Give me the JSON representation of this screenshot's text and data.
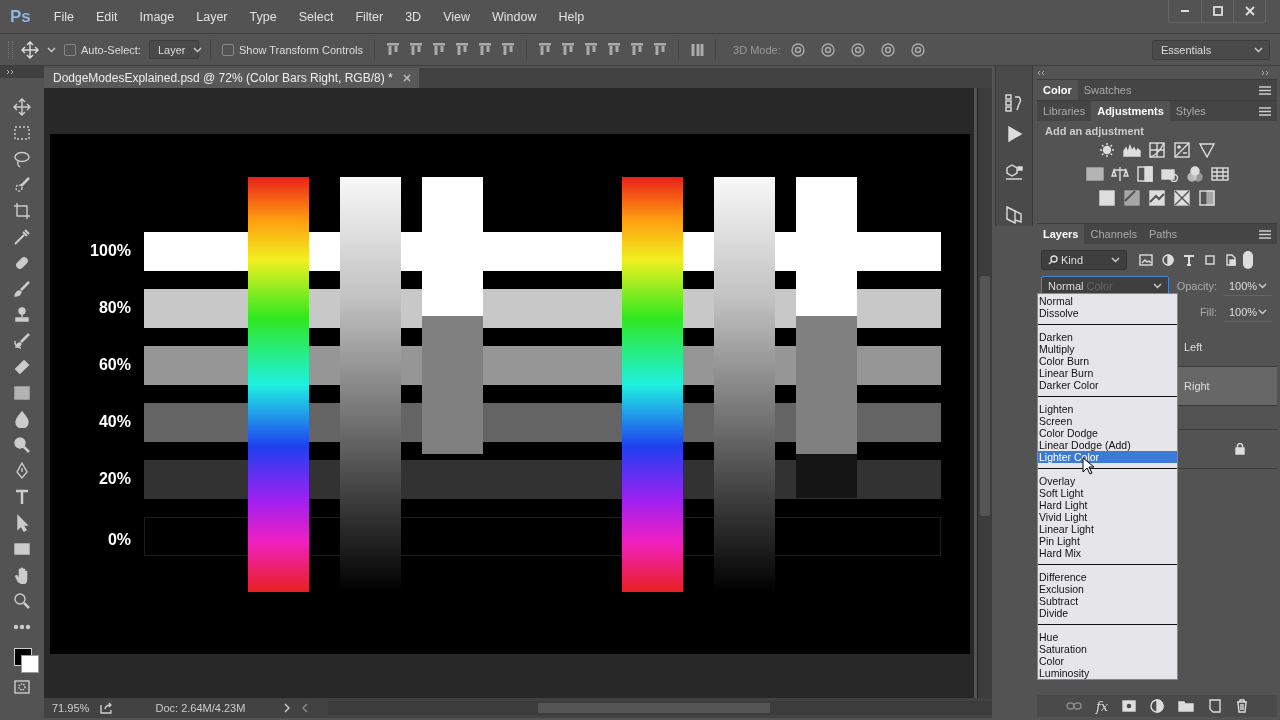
{
  "app": {
    "logo": "Ps",
    "menu": [
      "File",
      "Edit",
      "Image",
      "Layer",
      "Type",
      "Select",
      "Filter",
      "3D",
      "View",
      "Window",
      "Help"
    ]
  },
  "options_bar": {
    "auto_select": {
      "label": "Auto-Select:",
      "checked": false
    },
    "auto_select_target": "Layer",
    "show_transform": {
      "label": "Show Transform Controls",
      "checked": false
    },
    "mode_3d_label": "3D Mode:",
    "workspace": "Essentials"
  },
  "document": {
    "tab_title": "DodgeModesExplained.psd @ 72% (Color Bars Right, RGB/8) *",
    "canvas_labels": [
      "100%",
      "80%",
      "60%",
      "40%",
      "20%",
      "0%"
    ]
  },
  "status_bar": {
    "zoom": "71.95%",
    "doc_info": "Doc: 2.64M/4.23M"
  },
  "color_group": {
    "tabs": [
      {
        "label": "Color",
        "selected": true
      },
      {
        "label": "Swatches",
        "selected": false
      }
    ]
  },
  "adjustments_group": {
    "tabs": [
      {
        "label": "Libraries",
        "selected": false
      },
      {
        "label": "Adjustments",
        "selected": true
      },
      {
        "label": "Styles",
        "selected": false
      }
    ],
    "heading": "Add an adjustment"
  },
  "layers_group": {
    "tabs": [
      {
        "label": "Layers",
        "selected": true
      },
      {
        "label": "Channels",
        "selected": false
      },
      {
        "label": "Paths",
        "selected": false
      }
    ],
    "filter_kind": "Kind",
    "blend_mode": "Normal",
    "blend_mode_preview": "Color",
    "opacity_label": "Opacity:",
    "opacity": "100%",
    "fill_label": "Fill:",
    "fill": "100%",
    "layers": [
      {
        "name": "Left",
        "selected": false,
        "locked": false
      },
      {
        "name": "Right",
        "selected": true,
        "locked": false
      },
      {
        "selected": false,
        "locked": false
      },
      {
        "selected": false,
        "locked": true
      }
    ],
    "footer_fx": "fx"
  },
  "blend_menu": {
    "groups": [
      [
        {
          "label": "Normal",
          "selected": false
        },
        {
          "label": "Dissolve",
          "selected": false
        }
      ],
      [
        {
          "label": "Darken",
          "selected": false
        },
        {
          "label": "Multiply",
          "selected": false
        },
        {
          "label": "Color Burn",
          "selected": false
        },
        {
          "label": "Linear Burn",
          "selected": false
        },
        {
          "label": "Darker Color",
          "selected": false
        }
      ],
      [
        {
          "label": "Lighten",
          "selected": false
        },
        {
          "label": "Screen",
          "selected": false
        },
        {
          "label": "Color Dodge",
          "selected": false
        },
        {
          "label": "Linear Dodge (Add)",
          "selected": false
        },
        {
          "label": "Lighter Color",
          "selected": true
        }
      ],
      [
        {
          "label": "Overlay",
          "selected": false
        },
        {
          "label": "Soft Light",
          "selected": false
        },
        {
          "label": "Hard Light",
          "selected": false
        },
        {
          "label": "Vivid Light",
          "selected": false
        },
        {
          "label": "Linear Light",
          "selected": false
        },
        {
          "label": "Pin Light",
          "selected": false
        },
        {
          "label": "Hard Mix",
          "selected": false
        }
      ],
      [
        {
          "label": "Difference",
          "selected": false
        },
        {
          "label": "Exclusion",
          "selected": false
        },
        {
          "label": "Subtract",
          "selected": false
        },
        {
          "label": "Divide",
          "selected": false
        }
      ],
      [
        {
          "label": "Hue",
          "selected": false
        },
        {
          "label": "Saturation",
          "selected": false
        },
        {
          "label": "Color",
          "selected": false
        },
        {
          "label": "Luminosity",
          "selected": false
        }
      ]
    ]
  }
}
